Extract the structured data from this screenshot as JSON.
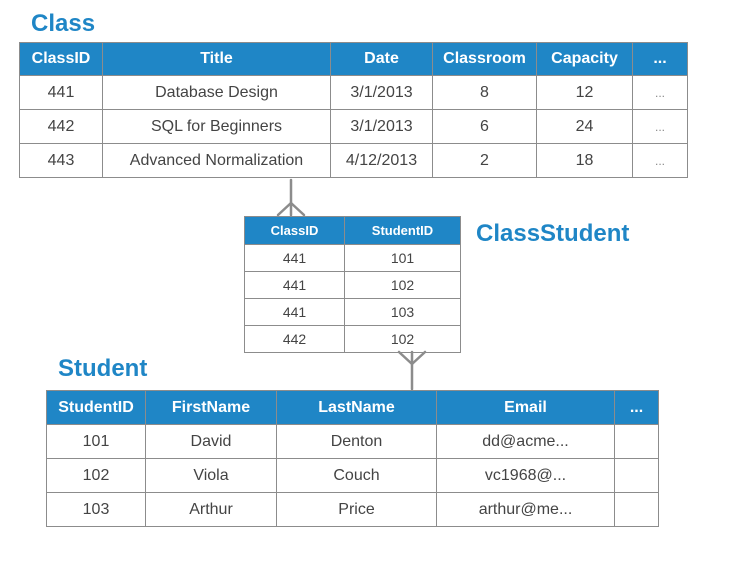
{
  "class": {
    "title": "Class",
    "columns": [
      "ClassID",
      "Title",
      "Date",
      "Classroom",
      "Capacity",
      "..."
    ],
    "rows": [
      [
        "441",
        "Database Design",
        "3/1/2013",
        "8",
        "12",
        "..."
      ],
      [
        "442",
        "SQL for Beginners",
        "3/1/2013",
        "6",
        "24",
        "..."
      ],
      [
        "443",
        "Advanced Normalization",
        "4/12/2013",
        "2",
        "18",
        "..."
      ]
    ]
  },
  "class_student": {
    "title": "ClassStudent",
    "columns": [
      "ClassID",
      "StudentID"
    ],
    "rows": [
      [
        "441",
        "101"
      ],
      [
        "441",
        "102"
      ],
      [
        "441",
        "103"
      ],
      [
        "442",
        "102"
      ]
    ]
  },
  "student": {
    "title": "Student",
    "columns": [
      "StudentID",
      "FirstName",
      "LastName",
      "Email",
      "..."
    ],
    "rows": [
      [
        "101",
        "David",
        "Denton",
        "dd@acme...",
        ""
      ],
      [
        "102",
        "Viola",
        "Couch",
        "vc1968@...",
        ""
      ],
      [
        "103",
        "Arthur",
        "Price",
        "arthur@me...",
        ""
      ]
    ]
  },
  "colors": {
    "header": "#1f86c6",
    "title": "#1f86c6",
    "border": "#8c8c8c",
    "cell_text": "#444444",
    "connector": "#8c8c8c"
  }
}
